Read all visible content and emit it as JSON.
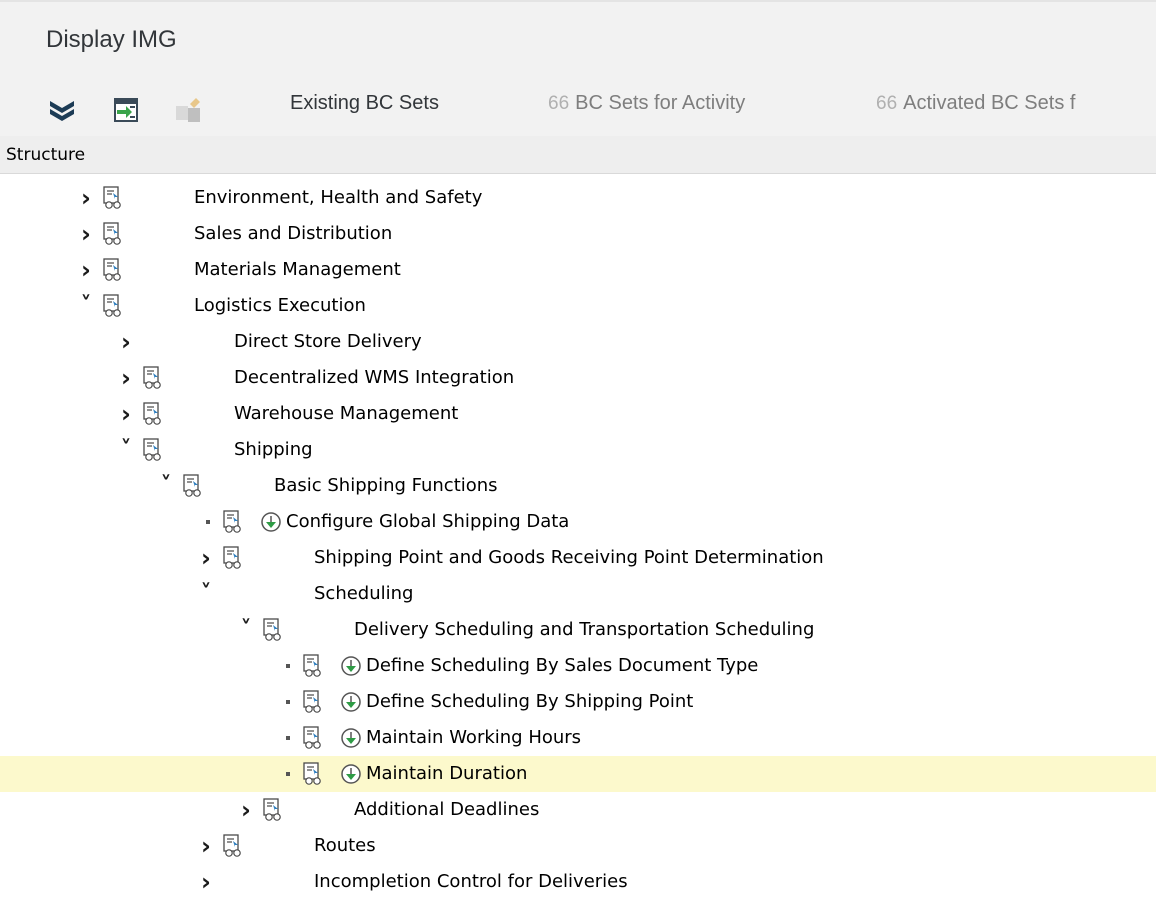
{
  "window": {
    "title": "Display IMG"
  },
  "toolbar": {
    "icons": [
      "expand-all-icon",
      "execute-icon",
      "bc-set-change-icon"
    ],
    "buttons": [
      {
        "label": "Existing BC Sets",
        "enabled": true
      },
      {
        "label": "BC Sets for Activity",
        "enabled": false,
        "icon": "glasses-icon"
      },
      {
        "label": "Activated BC Sets f",
        "enabled": false,
        "icon": "glasses-icon"
      }
    ]
  },
  "structure": {
    "header": "Structure",
    "nodes": [
      {
        "label": "Environment, Health and Safety",
        "level": 0,
        "state": "collapsed",
        "doc": true,
        "exec": false
      },
      {
        "label": "Sales and Distribution",
        "level": 0,
        "state": "collapsed",
        "doc": true,
        "exec": false
      },
      {
        "label": "Materials Management",
        "level": 0,
        "state": "collapsed",
        "doc": true,
        "exec": false
      },
      {
        "label": "Logistics Execution",
        "level": 0,
        "state": "expanded",
        "doc": true,
        "exec": false
      },
      {
        "label": "Direct Store Delivery",
        "level": 1,
        "state": "collapsed",
        "doc": false,
        "exec": false
      },
      {
        "label": "Decentralized WMS Integration",
        "level": 1,
        "state": "collapsed",
        "doc": true,
        "exec": false
      },
      {
        "label": "Warehouse Management",
        "level": 1,
        "state": "collapsed",
        "doc": true,
        "exec": false
      },
      {
        "label": "Shipping",
        "level": 1,
        "state": "expanded",
        "doc": true,
        "exec": false
      },
      {
        "label": "Basic Shipping Functions",
        "level": 2,
        "state": "expanded",
        "doc": true,
        "exec": false
      },
      {
        "label": "Configure Global Shipping Data",
        "level": 3,
        "state": "leaf",
        "doc": true,
        "exec": true
      },
      {
        "label": "Shipping Point and Goods Receiving Point Determination",
        "level": 3,
        "state": "collapsed",
        "doc": true,
        "exec": false
      },
      {
        "label": "Scheduling",
        "level": 3,
        "state": "expanded",
        "doc": false,
        "exec": false
      },
      {
        "label": "Delivery Scheduling and Transportation Scheduling",
        "level": 4,
        "state": "expanded",
        "doc": true,
        "exec": false
      },
      {
        "label": "Define Scheduling By Sales Document Type",
        "level": 5,
        "state": "leaf",
        "doc": true,
        "exec": true
      },
      {
        "label": "Define Scheduling By Shipping Point",
        "level": 5,
        "state": "leaf",
        "doc": true,
        "exec": true
      },
      {
        "label": "Maintain Working Hours",
        "level": 5,
        "state": "leaf",
        "doc": true,
        "exec": true
      },
      {
        "label": "Maintain Duration",
        "level": 5,
        "state": "leaf",
        "doc": true,
        "exec": true,
        "selected": true
      },
      {
        "label": "Additional Deadlines",
        "level": 4,
        "state": "collapsed",
        "doc": true,
        "exec": false
      },
      {
        "label": "Routes",
        "level": 3,
        "state": "collapsed",
        "doc": true,
        "exec": false
      },
      {
        "label": "Incompletion Control for Deliveries",
        "level": 3,
        "state": "collapsed",
        "doc": false,
        "exec": false
      }
    ]
  },
  "colors": {
    "selected_row": "#fcf9cc",
    "exec_icon_green": "#2e9b45",
    "toolbar_bg": "#f2f2f2"
  }
}
